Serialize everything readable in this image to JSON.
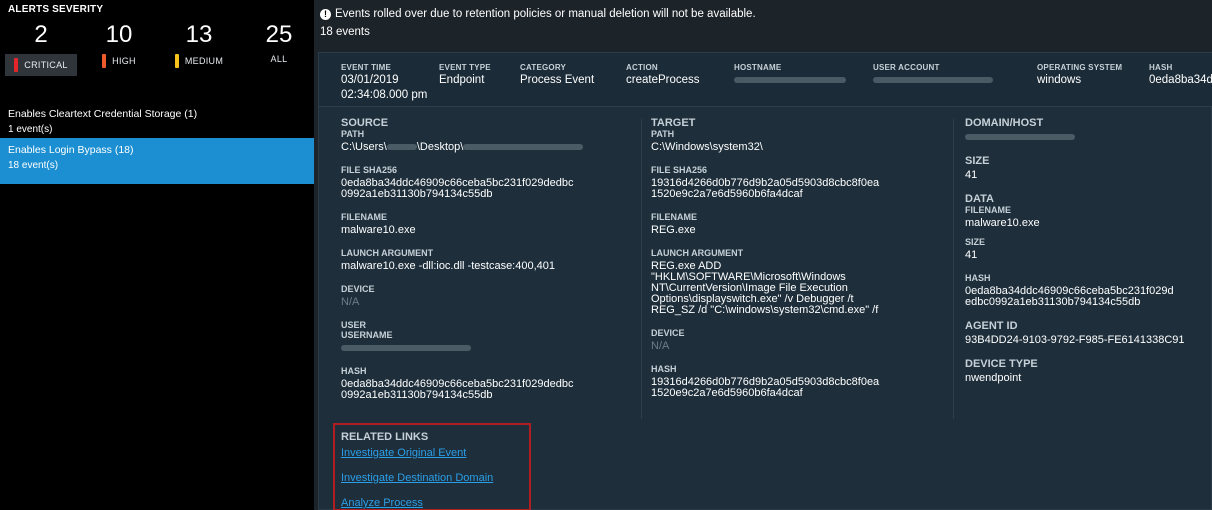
{
  "left": {
    "title": "ALERTS SEVERITY",
    "severities": [
      {
        "count": "2",
        "label": "CRITICAL",
        "color": "#e2262c"
      },
      {
        "count": "10",
        "label": "HIGH",
        "color": "#f15a2a"
      },
      {
        "count": "13",
        "label": "MEDIUM",
        "color": "#f7c11e"
      },
      {
        "count": "25",
        "label": "ALL",
        "color": ""
      }
    ],
    "alerts": [
      {
        "name": "Enables Cleartext Credential Storage (1)",
        "count": "1 event(s)"
      },
      {
        "name": "Enables Login Bypass (18)",
        "count": "18 event(s)"
      }
    ],
    "active_color": "#1b8fd1"
  },
  "banner": {
    "message": "Events rolled over due to retention policies or manual deletion will not be available.",
    "event_count": "18 events"
  },
  "header": {
    "event_time_label": "EVENT TIME",
    "event_time_date": "03/01/2019",
    "event_time_clock": "02:34:08.000 pm",
    "event_type_label": "EVENT TYPE",
    "event_type": "Endpoint",
    "category_label": "CATEGORY",
    "category": "Process Event",
    "action_label": "ACTION",
    "action": "createProcess",
    "hostname_label": "HOSTNAME",
    "user_account_label": "USER ACCOUNT",
    "os_label": "OPERATING SYSTEM",
    "os": "windows",
    "hash_label": "HASH",
    "hash": "0eda8ba34d"
  },
  "source": {
    "title": "SOURCE",
    "path_label": "PATH",
    "path_prefix": "C:\\Users\\",
    "path_mid": "\\Desktop\\",
    "sha_label": "FILE SHA256",
    "sha_1": "0eda8ba34ddc46909c66ceba5bc231f029dedbc",
    "sha_2": "0992a1eb31130b794134c55db",
    "filename_label": "FILENAME",
    "filename": "malware10.exe",
    "launch_label": "LAUNCH ARGUMENT",
    "launch": "malware10.exe -dll:ioc.dll -testcase:400,401",
    "device_label": "DEVICE",
    "device": "N/A",
    "user_label": "USER",
    "username_label": "USERNAME",
    "hash_label": "HASH",
    "hash_1": "0eda8ba34ddc46909c66ceba5bc231f029dedbc",
    "hash_2": "0992a1eb31130b794134c55db"
  },
  "target": {
    "title": "TARGET",
    "path_label": "PATH",
    "path": "C:\\Windows\\system32\\",
    "sha_label": "FILE SHA256",
    "sha_1": "19316d4266d0b776d9b2a05d5903d8cbc8f0ea",
    "sha_2": "1520e9c2a7e6d5960b6fa4dcaf",
    "filename_label": "FILENAME",
    "filename": "REG.exe",
    "launch_label": "LAUNCH ARGUMENT",
    "launch_1": "REG.exe ADD",
    "launch_2": "\"HKLM\\SOFTWARE\\Microsoft\\Windows",
    "launch_3": "NT\\CurrentVersion\\Image File Execution",
    "launch_4": "Options\\displayswitch.exe\" /v Debugger /t",
    "launch_5": "REG_SZ /d \"C:\\windows\\system32\\cmd.exe\" /f",
    "device_label": "DEVICE",
    "device": "N/A",
    "hash_label": "HASH",
    "hash_1": "19316d4266d0b776d9b2a05d5903d8cbc8f0ea",
    "hash_2": "1520e9c2a7e6d5960b6fa4dcaf"
  },
  "domain": {
    "title": "DOMAIN/HOST",
    "size_title": "SIZE",
    "size": "41",
    "data_title": "DATA",
    "filename_label": "FILENAME",
    "filename": "malware10.exe",
    "size_label": "SIZE",
    "size2": "41",
    "hash_label": "HASH",
    "hash_1": "0eda8ba34ddc46909c66ceba5bc231f029d",
    "hash_2": "edbc0992a1eb31130b794134c55db",
    "agent_title": "AGENT ID",
    "agent": "93B4DD24-9103-9792-F985-FE6141338C91",
    "devtype_title": "DEVICE TYPE",
    "devtype": "nwendpoint"
  },
  "links": {
    "title": "RELATED LINKS",
    "items": [
      "Investigate Original Event",
      "Investigate Destination Domain",
      "Analyze Process"
    ],
    "link_color": "#2b9ee8",
    "highlight_color": "#b11e22"
  }
}
